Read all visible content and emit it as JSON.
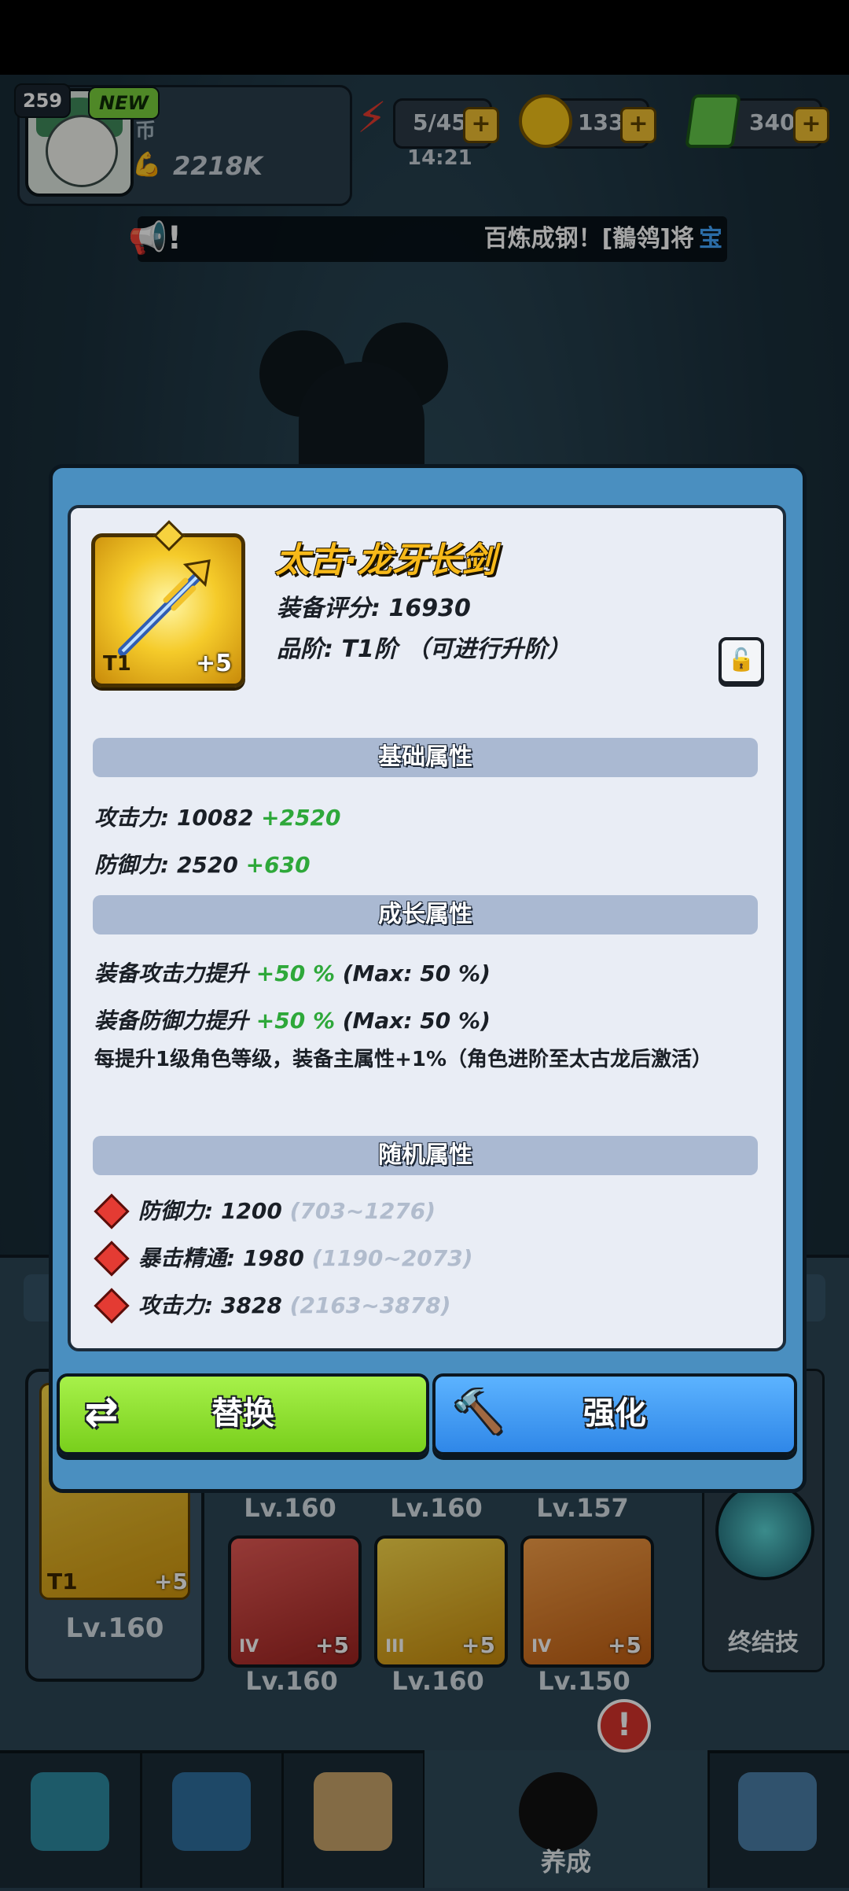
{
  "player": {
    "level": "259",
    "new_badge": "NEW",
    "coin_symbol": "币",
    "power": "2218K"
  },
  "resources": {
    "energy": "5/45",
    "energy_timer": "14:21",
    "gold": "133M",
    "gems": "3402",
    "plus": "+"
  },
  "announcement": {
    "text": "百炼成钢！[鶺鸰]将",
    "highlight": "宝"
  },
  "item": {
    "name": "太古·龙牙长剑",
    "score_label": "装备评分:",
    "score": "16930",
    "tier_label": "品阶:",
    "tier_text": "T1阶 （可进行升阶）",
    "tier_badge": "T1",
    "enhance": "+5"
  },
  "sections": {
    "base": "基础属性",
    "growth": "成长属性",
    "random": "随机属性"
  },
  "base_stats": [
    {
      "label": "攻击力:",
      "value": "10082",
      "bonus": "+2520"
    },
    {
      "label": "防御力:",
      "value": "2520",
      "bonus": "+630"
    }
  ],
  "growth_stats": [
    {
      "label": "装备攻击力提升",
      "value": "+50 %",
      "max": "(Max: 50 %)"
    },
    {
      "label": "装备防御力提升",
      "value": "+50 %",
      "max": "(Max: 50 %)"
    }
  ],
  "growth_note": "每提升1级角色等级，装备主属性+1%（角色进阶至太古龙后激活）",
  "random_stats": [
    {
      "label": "防御力:",
      "value": "1200",
      "range": "(703~1276)"
    },
    {
      "label": "暴击精通:",
      "value": "1980",
      "range": "(1190~2073)"
    },
    {
      "label": "攻击力:",
      "value": "3828",
      "range": "(2163~3878)"
    }
  ],
  "buttons": {
    "replace": "替换",
    "enhance": "强化"
  },
  "equipment": {
    "main": {
      "tier": "T1",
      "plus": "+5",
      "level": "Lv.160"
    },
    "row1_levels": [
      "Lv.160",
      "Lv.160",
      "Lv.157"
    ],
    "row2": [
      {
        "tier": "IV",
        "plus": "+5",
        "level": "Lv.160"
      },
      {
        "tier": "III",
        "plus": "+5",
        "level": "Lv.160"
      },
      {
        "tier": "IV",
        "plus": "+5",
        "level": "Lv.150"
      }
    ],
    "ultimate_label": "终结技"
  },
  "nav": {
    "active_label": "养成",
    "alert": "!"
  },
  "colors": {
    "accent_gold": "#f7b919",
    "bonus_green": "#2ea83a",
    "replace_green": "#8fe233",
    "enhance_blue": "#3f9bf5"
  }
}
